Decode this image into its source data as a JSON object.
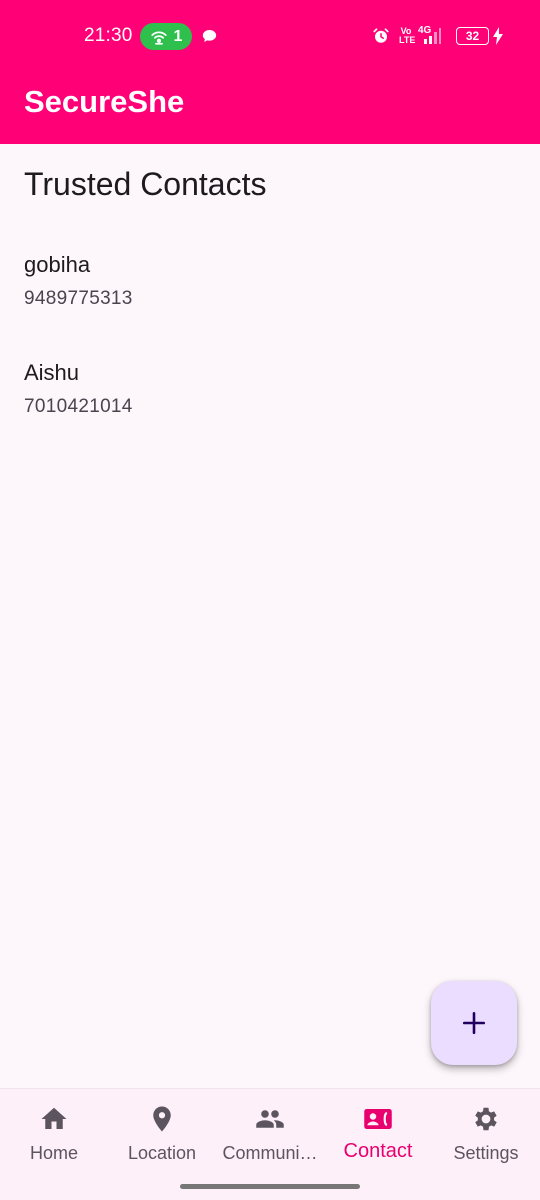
{
  "status_bar": {
    "time": "21:30",
    "hotspot_count": "1",
    "volte": "Vo LTE",
    "network": "4G",
    "battery": "32",
    "icons": [
      "hotspot-icon",
      "chat-icon",
      "alarm-icon",
      "signal-icon",
      "battery-icon",
      "charging-icon"
    ]
  },
  "app_bar": {
    "title": "SecureShe",
    "color": "#ff0077"
  },
  "page": {
    "title": "Trusted Contacts",
    "contacts": [
      {
        "name": "gobiha",
        "phone": "9489775313"
      },
      {
        "name": "Aishu",
        "phone": "7010421014"
      }
    ]
  },
  "fab": {
    "icon": "plus-icon",
    "color": "#eaddff"
  },
  "bottom_nav": {
    "active_color": "#e8006f",
    "items": [
      {
        "label": "Home",
        "icon": "home-icon"
      },
      {
        "label": "Location",
        "icon": "location-pin-icon"
      },
      {
        "label": "Communi…",
        "icon": "people-icon"
      },
      {
        "label": "Contact",
        "icon": "contact-phone-icon",
        "active": true
      },
      {
        "label": "Settings",
        "icon": "gear-icon"
      }
    ]
  }
}
